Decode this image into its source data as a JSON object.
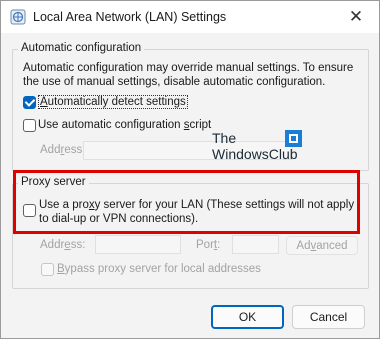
{
  "window": {
    "title": "Local Area Network (LAN) Settings",
    "close_glyph": "✕"
  },
  "auto_config": {
    "legend": "Automatic configuration",
    "description": "Automatic configuration may override manual settings.  To ensure the use of manual settings, disable automatic configuration.",
    "auto_detect": {
      "label_pre": "",
      "label_ul": "A",
      "label_post": "utomatically detect settings",
      "checked": true
    },
    "use_script": {
      "label_pre": "Use automatic configuration ",
      "label_ul": "s",
      "label_post": "cript",
      "checked": false
    },
    "address": {
      "label_pre": "Add",
      "label_ul": "r",
      "label_post": "ess",
      "value": ""
    }
  },
  "watermark": {
    "line1": "The",
    "line2": "WindowsClub"
  },
  "proxy": {
    "legend": "Proxy server",
    "use_proxy": {
      "label_pre": "Use a pro",
      "label_ul": "x",
      "label_post": "y server for your LAN (These settings will not apply to dial-up or VPN connections).",
      "checked": false
    },
    "address": {
      "label_pre": "Addr",
      "label_ul": "e",
      "label_post": "ss:",
      "value": ""
    },
    "port": {
      "label_pre": "Por",
      "label_ul": "t",
      "label_post": ":",
      "value": ""
    },
    "advanced_label_pre": "Ad",
    "advanced_label_ul": "v",
    "advanced_label_post": "anced",
    "bypass": {
      "label_pre": "",
      "label_ul": "B",
      "label_post": "ypass proxy server for local addresses",
      "checked": false
    }
  },
  "buttons": {
    "ok": "OK",
    "cancel": "Cancel"
  },
  "colors": {
    "accent": "#0067c0",
    "highlight": "#e00000"
  }
}
